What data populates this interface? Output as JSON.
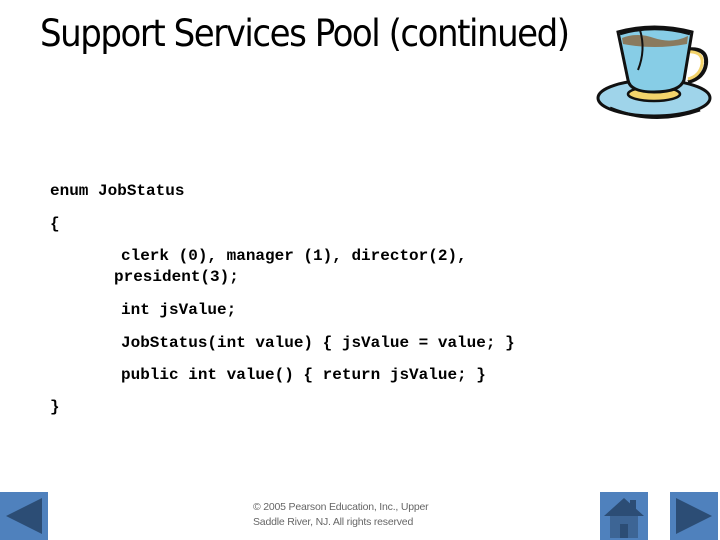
{
  "slide": {
    "title": "Support Services Pool (continued)",
    "clipart": "teacup-icon",
    "code_lines": [
      "enum JobStatus",
      "{",
      "clerk (0), manager (1), director(2),",
      "president(3);",
      "int jsValue;",
      "JobStatus(int value) { jsValue = value; }",
      "public int value() { return jsValue; }",
      "}"
    ],
    "footer": {
      "line1": "© 2005 Pearson Education, Inc., Upper",
      "line2": "Saddle River, NJ.  All rights reserved"
    }
  },
  "navigation": {
    "previous": {
      "icon": "previous-arrow-icon"
    },
    "home": {
      "icon": "home-icon"
    },
    "next": {
      "icon": "next-arrow-icon"
    },
    "button_color": "#4f81bd",
    "glyph_color": "#2c4d75"
  }
}
